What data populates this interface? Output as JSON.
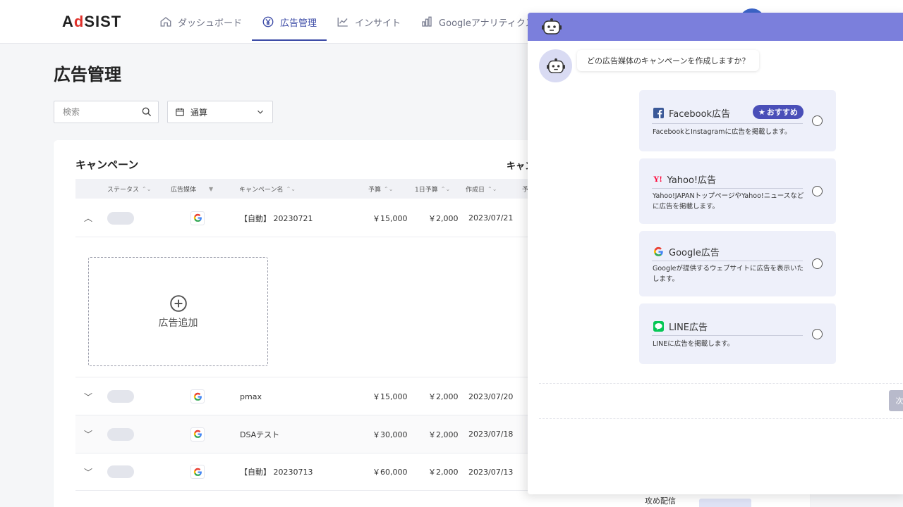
{
  "header": {
    "logo_prefix": "A",
    "logo_accent": "d",
    "logo_suffix": "SIST",
    "nav": [
      {
        "label": "ダッシュボード",
        "icon": "home-icon"
      },
      {
        "label": "広告管理",
        "icon": "yen-icon",
        "active": true
      },
      {
        "label": "インサイト",
        "icon": "trend-icon"
      },
      {
        "label": "Googleアナリティクス",
        "icon": "bar-chart-icon"
      }
    ]
  },
  "page": {
    "title": "広告管理",
    "search_placeholder": "検索",
    "period_label": "通算"
  },
  "campaigns": {
    "title": "キャンペーン",
    "title_right": "キャン",
    "columns": [
      "ステータス",
      "広告媒体",
      "キャンペーン名",
      "予算",
      "1日予算",
      "作成日",
      "予"
    ],
    "rows": [
      {
        "name": "【自動】 20230721",
        "budget": "￥15,000",
        "daily": "￥2,000",
        "date": "2023/07/21",
        "expanded": true
      },
      {
        "name": "pmax",
        "budget": "￥15,000",
        "daily": "￥2,000",
        "date": "2023/07/20"
      },
      {
        "name": "DSAテスト",
        "budget": "￥30,000",
        "daily": "￥2,000",
        "date": "2023/07/18"
      },
      {
        "name": "【自動】 20230713",
        "budget": "￥60,000",
        "daily": "￥2,000",
        "date": "2023/07/13"
      }
    ],
    "add_ad_label": "広告追加",
    "bottom_text": "攻め配信"
  },
  "chat": {
    "question": "どの広告媒体のキャンペーンを作成しますか？",
    "recommend_label": "おすすめ",
    "send_label": "次",
    "options": [
      {
        "title": "Facebook広告",
        "desc": "FacebookとInstagramに広告を掲載します。",
        "icon": "facebook-icon",
        "recommended": true
      },
      {
        "title": "Yahoo!広告",
        "desc": "Yahoo!JAPANトップページやYahoo!ニュースなどに広告を掲載します。",
        "icon": "yahoo-icon"
      },
      {
        "title": "Google広告",
        "desc": "Googleが提供するウェブサイトに広告を表示いたします。",
        "icon": "google-icon"
      },
      {
        "title": "LINE広告",
        "desc": "LINEに広告を掲載します。",
        "icon": "line-icon"
      }
    ]
  },
  "colors": {
    "accent": "#3b4aa6",
    "chat_header": "#7b7fdc",
    "option_bg": "#eef0fa",
    "logo_red": "#e0312b"
  }
}
